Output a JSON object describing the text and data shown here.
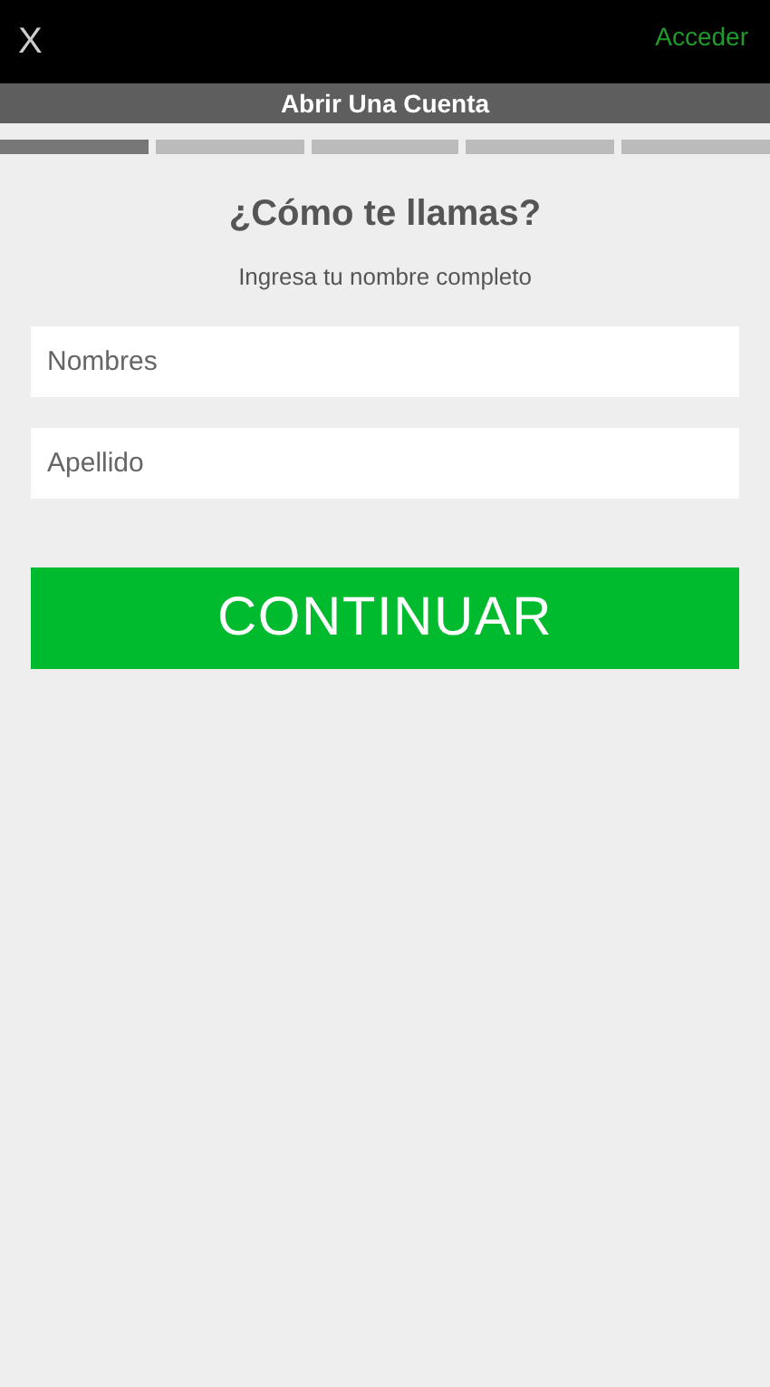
{
  "top_bar": {
    "close": "X",
    "login_link": "Acceder"
  },
  "header": {
    "title": "Abrir Una Cuenta"
  },
  "steps": [
    {
      "selected": true
    },
    {
      "selected": false
    },
    {
      "selected": false
    },
    {
      "selected": false
    },
    {
      "selected": false
    }
  ],
  "heading": "¿Cómo te llamas?",
  "subheading": "Ingresa tu nombre completo",
  "fields": [
    {
      "placeholder": "Nombres"
    },
    {
      "placeholder": "Apellido"
    }
  ],
  "continue_button": "CONTINUAR"
}
